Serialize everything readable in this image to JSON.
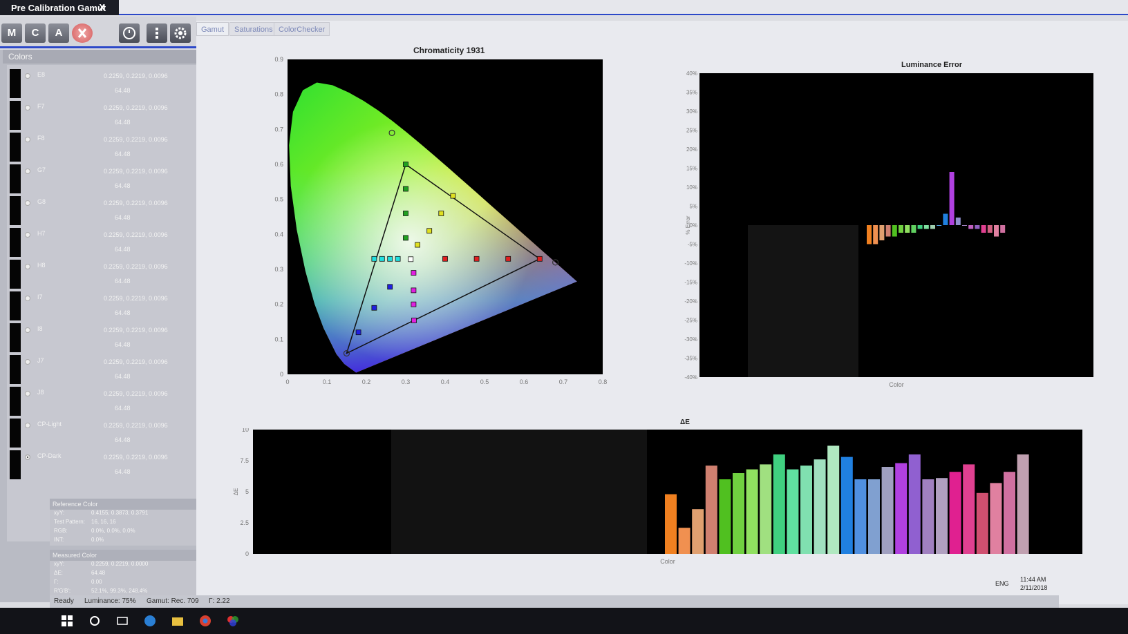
{
  "window": {
    "title": "Pre Calibration Gamut",
    "close_label": "X"
  },
  "toolbar": {
    "buttons": [
      "M",
      "C",
      "A"
    ]
  },
  "tabs": [
    "Gamut",
    "Saturations",
    "ColorChecker"
  ],
  "colors_panel": {
    "header": "Colors",
    "rows": [
      {
        "name": "E8",
        "xyz": "0.2259, 0.2219, 0.0096",
        "lum": "64.48",
        "selected": false
      },
      {
        "name": "F7",
        "xyz": "0.2259, 0.2219, 0.0096",
        "lum": "64.48",
        "selected": false
      },
      {
        "name": "F8",
        "xyz": "0.2259, 0.2219, 0.0096",
        "lum": "64.48",
        "selected": false
      },
      {
        "name": "G7",
        "xyz": "0.2259, 0.2219, 0.0096",
        "lum": "64.48",
        "selected": false
      },
      {
        "name": "G8",
        "xyz": "0.2259, 0.2219, 0.0096",
        "lum": "64.48",
        "selected": false
      },
      {
        "name": "H7",
        "xyz": "0.2259, 0.2219, 0.0096",
        "lum": "64.48",
        "selected": false
      },
      {
        "name": "H8",
        "xyz": "0.2259, 0.2219, 0.0096",
        "lum": "64.48",
        "selected": false
      },
      {
        "name": "I7",
        "xyz": "0.2259, 0.2219, 0.0096",
        "lum": "64.48",
        "selected": false
      },
      {
        "name": "I8",
        "xyz": "0.2259, 0.2219, 0.0096",
        "lum": "64.48",
        "selected": false
      },
      {
        "name": "J7",
        "xyz": "0.2259, 0.2219, 0.0096",
        "lum": "64.48",
        "selected": false
      },
      {
        "name": "J8",
        "xyz": "0.2259, 0.2219, 0.0096",
        "lum": "64.48",
        "selected": false
      },
      {
        "name": "CP-Light",
        "xyz": "0.2259, 0.2219, 0.0096",
        "lum": "64.48",
        "selected": false
      },
      {
        "name": "CP-Dark",
        "xyz": "0.2259, 0.2219, 0.0096",
        "lum": "64.48",
        "selected": true
      }
    ]
  },
  "reference_color": {
    "title": "Reference Color",
    "lines": [
      {
        "k": "xyY:",
        "v": "0.4155, 0.3873, 0.3791"
      },
      {
        "k": "Test Pattern:",
        "v": "16, 16, 16"
      },
      {
        "k": "RGB:",
        "v": "0.0%, 0.0%, 0.0%"
      },
      {
        "k": "INT:",
        "v": "0.0%"
      }
    ]
  },
  "measured_color": {
    "title": "Measured Color",
    "lines": [
      {
        "k": "xyY:",
        "v": "0.2259, 0.2219, 0.0000"
      },
      {
        "k": "ΔE:",
        "v": "64.48"
      },
      {
        "k": "Γ:",
        "v": "0.00"
      },
      {
        "k": "R'G'B':",
        "v": "52.1%, 99.3%, 248.4%"
      }
    ]
  },
  "status": {
    "ready": "Ready",
    "luminance": "Luminance: 75%",
    "gamut": "Gamut: Rec. 709",
    "gamma": "Γ: 2.22"
  },
  "tray": {
    "lang": "ENG",
    "time": "11:44 AM",
    "date": "2/11/2018"
  },
  "chart_data": [
    {
      "type": "scatter",
      "title": "Chromaticity 1931",
      "xlim": [
        0,
        0.8
      ],
      "ylim": [
        0,
        0.9
      ],
      "xticks": [
        "0",
        "0.1",
        "0.2",
        "0.3",
        "0.4",
        "0.5",
        "0.6",
        "0.7",
        "0.8"
      ],
      "yticks": [
        "0",
        "0.1",
        "0.2",
        "0.3",
        "0.4",
        "0.5",
        "0.6",
        "0.7",
        "0.8",
        "0.9"
      ],
      "target_triangle": [
        [
          0.64,
          0.33
        ],
        [
          0.3,
          0.6
        ],
        [
          0.15,
          0.06
        ]
      ],
      "measured_primaries": [
        [
          0.68,
          0.32
        ],
        [
          0.265,
          0.69
        ],
        [
          0.15,
          0.06
        ]
      ],
      "points": [
        {
          "x": 0.64,
          "y": 0.33,
          "c": "#e02020"
        },
        {
          "x": 0.56,
          "y": 0.33,
          "c": "#e02020"
        },
        {
          "x": 0.48,
          "y": 0.33,
          "c": "#e02020"
        },
        {
          "x": 0.4,
          "y": 0.33,
          "c": "#e02020"
        },
        {
          "x": 0.3,
          "y": 0.6,
          "c": "#20a020"
        },
        {
          "x": 0.3,
          "y": 0.53,
          "c": "#20a020"
        },
        {
          "x": 0.3,
          "y": 0.46,
          "c": "#20a020"
        },
        {
          "x": 0.3,
          "y": 0.39,
          "c": "#20a020"
        },
        {
          "x": 0.42,
          "y": 0.51,
          "c": "#e0e020"
        },
        {
          "x": 0.39,
          "y": 0.46,
          "c": "#e0e020"
        },
        {
          "x": 0.36,
          "y": 0.41,
          "c": "#e0e020"
        },
        {
          "x": 0.33,
          "y": 0.37,
          "c": "#e0e020"
        },
        {
          "x": 0.22,
          "y": 0.33,
          "c": "#20e0e0"
        },
        {
          "x": 0.24,
          "y": 0.33,
          "c": "#20e0e0"
        },
        {
          "x": 0.26,
          "y": 0.33,
          "c": "#20e0e0"
        },
        {
          "x": 0.28,
          "y": 0.33,
          "c": "#20e0e0"
        },
        {
          "x": 0.321,
          "y": 0.154,
          "c": "#e020e0"
        },
        {
          "x": 0.32,
          "y": 0.2,
          "c": "#e020e0"
        },
        {
          "x": 0.32,
          "y": 0.24,
          "c": "#e020e0"
        },
        {
          "x": 0.32,
          "y": 0.29,
          "c": "#e020e0"
        },
        {
          "x": 0.18,
          "y": 0.12,
          "c": "#2020e0"
        },
        {
          "x": 0.22,
          "y": 0.19,
          "c": "#2020e0"
        },
        {
          "x": 0.26,
          "y": 0.25,
          "c": "#2020e0"
        },
        {
          "x": 0.3127,
          "y": 0.329,
          "c": "#ffffff"
        }
      ]
    },
    {
      "type": "bar",
      "title": "Luminance Error",
      "ylabel": "% Error",
      "xlabel": "Color",
      "yticks": [
        "40%",
        "35%",
        "30%",
        "25%",
        "20%",
        "15%",
        "10%",
        "5%",
        "0%",
        "-5%",
        "-10%",
        "-15%",
        "-20%",
        "-25%",
        "-30%",
        "-35%",
        "-40%"
      ],
      "ylim": [
        -40,
        40
      ],
      "values": [
        -5,
        -5,
        -4,
        -3,
        -3,
        -2,
        -2,
        -2,
        -1,
        -1,
        -1,
        0,
        3,
        14,
        2,
        0,
        -1,
        -1,
        -2,
        -2,
        -3,
        -2
      ],
      "colors": [
        "#f08020",
        "#f09050",
        "#e0a070",
        "#d08070",
        "#50c020",
        "#70d040",
        "#90e060",
        "#60d060",
        "#40d080",
        "#80e0a0",
        "#a0d0b0",
        "#50a0e0",
        "#2080e0",
        "#b040e0",
        "#9090d0",
        "#a080c0",
        "#c060c0",
        "#9060c0",
        "#e04090",
        "#d06080",
        "#e080a0",
        "#d070a0"
      ]
    },
    {
      "type": "bar",
      "title": "ΔE",
      "ylabel": "ΔE",
      "xlabel": "Color",
      "yticks": [
        "10",
        "7.5",
        "5",
        "2.5",
        "0"
      ],
      "ylim": [
        0,
        10
      ],
      "values": [
        4.8,
        2.1,
        3.6,
        7.1,
        6.0,
        6.5,
        6.8,
        7.2,
        8.0,
        6.8,
        7.1,
        7.6,
        8.7,
        7.8,
        6.0,
        6.0,
        7.0,
        7.3,
        8.0,
        6.0,
        6.1,
        6.6,
        7.2,
        4.9,
        5.7,
        6.6,
        8.0
      ],
      "colors": [
        "#f08020",
        "#f09050",
        "#e0a070",
        "#d08070",
        "#50c020",
        "#70d040",
        "#90e060",
        "#a0e080",
        "#40d080",
        "#60e0a0",
        "#80e0b0",
        "#a0e0c0",
        "#b0e8c0",
        "#2080e0",
        "#5090e0",
        "#80a0d0",
        "#a0a0c0",
        "#b040e0",
        "#9060d0",
        "#a080c0",
        "#b0a0c0",
        "#e02090",
        "#e04090",
        "#d05070",
        "#e080a0",
        "#d070a0",
        "#c0a0b0"
      ]
    }
  ]
}
